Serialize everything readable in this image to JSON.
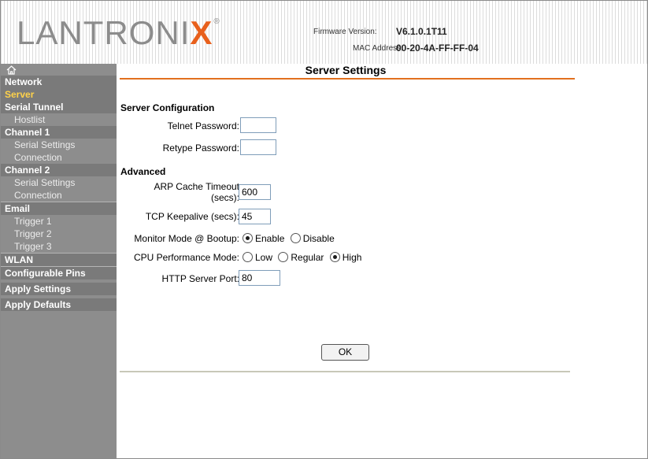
{
  "header": {
    "logo_text": "LANTRONIX",
    "firmware_label": "Firmware Version:",
    "firmware_value": "V6.1.0.1T11",
    "mac_label": "MAC Address:",
    "mac_value": "00-20-4A-FF-FF-04",
    "accent_color": "#e8601c"
  },
  "sidebar": {
    "home_icon": "home-icon",
    "items": [
      {
        "label": "Network",
        "type": "header"
      },
      {
        "label": "Server",
        "type": "active"
      },
      {
        "label": "Serial Tunnel",
        "type": "header"
      },
      {
        "label": "Hostlist",
        "type": "sub"
      },
      {
        "label": "Channel 1",
        "type": "header"
      },
      {
        "label": "Serial Settings",
        "type": "sub"
      },
      {
        "label": "Connection",
        "type": "sub"
      },
      {
        "label": "Channel 2",
        "type": "header"
      },
      {
        "label": "Serial Settings",
        "type": "sub"
      },
      {
        "label": "Connection",
        "type": "sub"
      },
      {
        "label": "Email",
        "type": "header"
      },
      {
        "label": "Trigger 1",
        "type": "sub"
      },
      {
        "label": "Trigger 2",
        "type": "sub"
      },
      {
        "label": "Trigger 3",
        "type": "sub"
      },
      {
        "label": "WLAN",
        "type": "header"
      },
      {
        "label": "Configurable Pins",
        "type": "header"
      },
      {
        "label": "Apply Settings",
        "type": "header"
      },
      {
        "label": "Apply Defaults",
        "type": "header"
      }
    ]
  },
  "main": {
    "title": "Server Settings",
    "server_config": {
      "heading": "Server Configuration",
      "telnet_password_label": "Telnet Password:",
      "telnet_password_value": "",
      "retype_password_label": "Retype Password:",
      "retype_password_value": ""
    },
    "advanced": {
      "heading": "Advanced",
      "arp_label_line1": "ARP Cache Timeout",
      "arp_label_line2": "(secs):",
      "arp_value": "600",
      "tcp_keepalive_label": "TCP Keepalive (secs):",
      "tcp_keepalive_value": "45",
      "monitor_mode_label": "Monitor Mode @ Bootup:",
      "monitor_mode_options": [
        "Enable",
        "Disable"
      ],
      "monitor_mode_selected": "Enable",
      "cpu_mode_label": "CPU Performance Mode:",
      "cpu_mode_options": [
        "Low",
        "Regular",
        "High"
      ],
      "cpu_mode_selected": "High",
      "http_port_label": "HTTP Server Port:",
      "http_port_value": "80"
    },
    "ok_label": "OK"
  }
}
